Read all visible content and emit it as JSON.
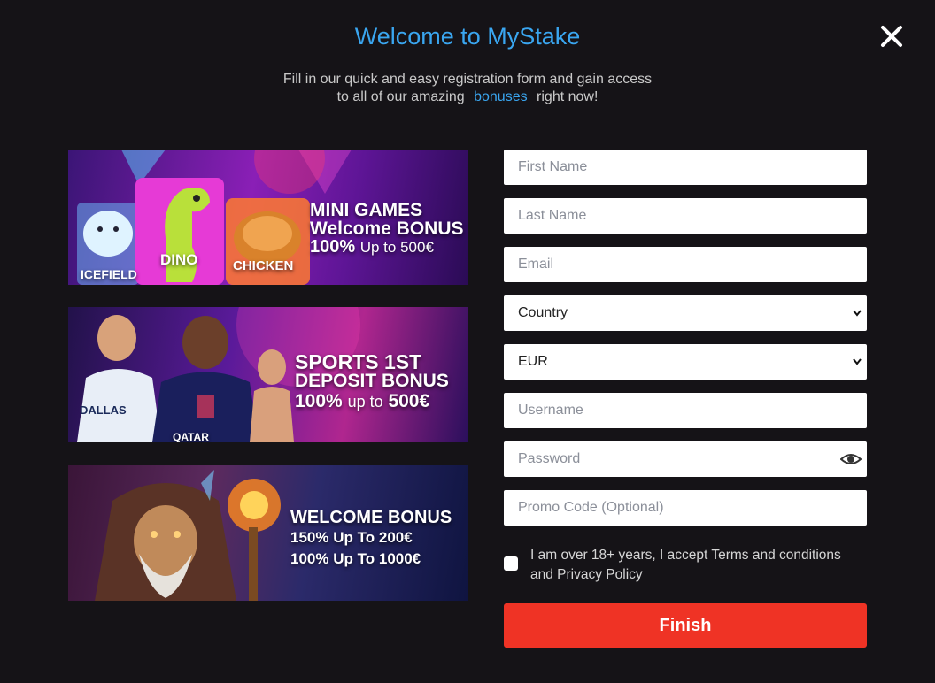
{
  "modal": {
    "title": "Welcome to MyStake",
    "subtitle_line1": "Fill in our quick and easy registration form and gain access",
    "subtitle_line2_before": "to all of our amazing",
    "subtitle_link": "bonuses",
    "subtitle_line2_after": "right now!",
    "close_icon": "close-icon"
  },
  "banners": [
    {
      "name": "mini-games",
      "line1": "MINI GAMES",
      "line2": "Welcome BONUS",
      "line3_pct": "100%",
      "line3_rest": "Up to 500€",
      "tile_labels": [
        "ICEFIELD",
        "DINO",
        "CHICKEN"
      ]
    },
    {
      "name": "sports",
      "line1": "SPORTS 1ST",
      "line2": "DEPOSIT BONUS",
      "line3_pct": "100%",
      "line3_mid": "up to",
      "line3_amount": "500€",
      "jersey_text": "DALLAS",
      "sponsor_text": "QATAR"
    },
    {
      "name": "welcome",
      "line1": "WELCOME BONUS",
      "line2_pct": "150%",
      "line2_mid": "Up To",
      "line2_amount": "200€",
      "line3_pct": "100%",
      "line3_mid": "Up To",
      "line3_amount": "1000€"
    }
  ],
  "form": {
    "first_name_placeholder": "First Name",
    "last_name_placeholder": "Last Name",
    "email_placeholder": "Email",
    "country_value": "Country",
    "currency_value": "EUR",
    "username_placeholder": "Username",
    "password_placeholder": "Password",
    "promo_placeholder": "Promo Code (Optional)",
    "consent_text": "I am over 18+ years, I accept Terms and conditions and Privacy Policy",
    "consent_checked": false,
    "finish_label": "Finish",
    "password_toggle_icon": "eye-icon"
  },
  "colors": {
    "background": "#151317",
    "accent_blue": "#3aa6f0",
    "finish_red": "#ef3325"
  }
}
